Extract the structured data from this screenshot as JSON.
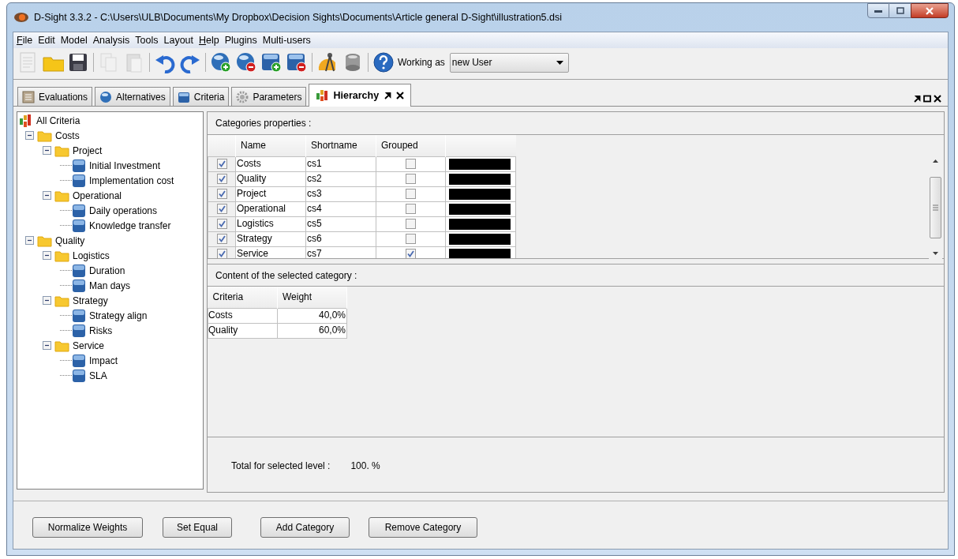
{
  "window": {
    "title": "D-Sight 3.3.2 - C:\\Users\\ULB\\Documents\\My Dropbox\\Decision Sights\\Documents\\Article general D-Sight\\illustration5.dsi"
  },
  "menu": [
    {
      "label": "File",
      "mnemonic": true
    },
    {
      "label": "Edit",
      "mnemonic": false
    },
    {
      "label": "Model",
      "mnemonic": false
    },
    {
      "label": "Analysis",
      "mnemonic": false
    },
    {
      "label": "Tools",
      "mnemonic": false
    },
    {
      "label": "Layout",
      "mnemonic": false
    },
    {
      "label": "Help",
      "mnemonic": true
    },
    {
      "label": "Plugins",
      "mnemonic": false
    },
    {
      "label": "Multi-users",
      "mnemonic": false
    }
  ],
  "toolbar": [
    {
      "kind": "new",
      "disabled": true
    },
    {
      "kind": "open",
      "disabled": false
    },
    {
      "kind": "save",
      "disabled": false
    },
    {
      "kind": "separator"
    },
    {
      "kind": "copy",
      "disabled": true
    },
    {
      "kind": "paste",
      "disabled": true
    },
    {
      "kind": "separator"
    },
    {
      "kind": "undo",
      "disabled": false
    },
    {
      "kind": "redo",
      "disabled": false
    },
    {
      "kind": "separator"
    },
    {
      "kind": "add-alternative",
      "disabled": false
    },
    {
      "kind": "remove-alternative",
      "disabled": false
    },
    {
      "kind": "add-criterion",
      "disabled": false
    },
    {
      "kind": "remove-criterion",
      "disabled": false
    },
    {
      "kind": "separator"
    },
    {
      "kind": "compass",
      "disabled": false
    },
    {
      "kind": "database",
      "disabled": false
    },
    {
      "kind": "separator"
    },
    {
      "kind": "help",
      "disabled": false
    }
  ],
  "user": {
    "label": "Working as",
    "value": "new User"
  },
  "tabs": [
    {
      "label": "Evaluations",
      "kind": "evaluations",
      "selected": false
    },
    {
      "label": "Alternatives",
      "kind": "alternatives",
      "selected": false
    },
    {
      "label": "Criteria",
      "kind": "criteria",
      "selected": false
    },
    {
      "label": "Parameters",
      "kind": "parameters",
      "selected": false
    },
    {
      "label": "Hierarchy",
      "kind": "hierarchy",
      "selected": true
    }
  ],
  "tree": {
    "label": "All Criteria",
    "kind": "root",
    "children": [
      {
        "label": "Costs",
        "kind": "folder",
        "expanded": true,
        "children": [
          {
            "label": "Project",
            "kind": "folder",
            "expanded": true,
            "children": [
              {
                "label": "Initial Investment",
                "kind": "criterion"
              },
              {
                "label": "Implementation cost",
                "kind": "criterion"
              }
            ]
          },
          {
            "label": "Operational",
            "kind": "folder",
            "expanded": true,
            "children": [
              {
                "label": "Daily operations",
                "kind": "criterion"
              },
              {
                "label": "Knowledge transfer",
                "kind": "criterion"
              }
            ]
          }
        ]
      },
      {
        "label": "Quality",
        "kind": "folder",
        "expanded": true,
        "children": [
          {
            "label": "Logistics",
            "kind": "folder",
            "expanded": true,
            "children": [
              {
                "label": "Duration",
                "kind": "criterion"
              },
              {
                "label": "Man days",
                "kind": "criterion"
              }
            ]
          },
          {
            "label": "Strategy",
            "kind": "folder",
            "expanded": true,
            "children": [
              {
                "label": "Strategy align",
                "kind": "criterion"
              },
              {
                "label": "Risks",
                "kind": "criterion"
              }
            ]
          },
          {
            "label": "Service",
            "kind": "folder",
            "expanded": true,
            "children": [
              {
                "label": "Impact",
                "kind": "criterion"
              },
              {
                "label": "SLA",
                "kind": "criterion"
              }
            ]
          }
        ]
      }
    ]
  },
  "categories": {
    "title": "Categories properties :",
    "columns": [
      "Name",
      "Shortname",
      "Grouped"
    ],
    "rows": [
      {
        "checked": true,
        "name": "Costs",
        "shortname": "cs1",
        "grouped": false,
        "color": "#000000"
      },
      {
        "checked": true,
        "name": "Quality",
        "shortname": "cs2",
        "grouped": false,
        "color": "#000000"
      },
      {
        "checked": true,
        "name": "Project",
        "shortname": "cs3",
        "grouped": false,
        "color": "#000000"
      },
      {
        "checked": true,
        "name": "Operational",
        "shortname": "cs4",
        "grouped": false,
        "color": "#000000"
      },
      {
        "checked": true,
        "name": "Logistics",
        "shortname": "cs5",
        "grouped": false,
        "color": "#000000"
      },
      {
        "checked": true,
        "name": "Strategy",
        "shortname": "cs6",
        "grouped": false,
        "color": "#000000"
      },
      {
        "checked": true,
        "name": "Service",
        "shortname": "cs7",
        "grouped": true,
        "color": "#000000"
      }
    ]
  },
  "content": {
    "title": "Content of the selected category :",
    "columns": [
      "Criteria",
      "Weight"
    ],
    "rows": [
      {
        "criteria": "Costs",
        "weight": "40,0%"
      },
      {
        "criteria": "Quality",
        "weight": "60,0%"
      }
    ]
  },
  "total": {
    "label": "Total for selected level :",
    "value": "100. %"
  },
  "buttons": [
    "Normalize Weights",
    "Set Equal",
    "Add Category",
    "Remove Category"
  ]
}
